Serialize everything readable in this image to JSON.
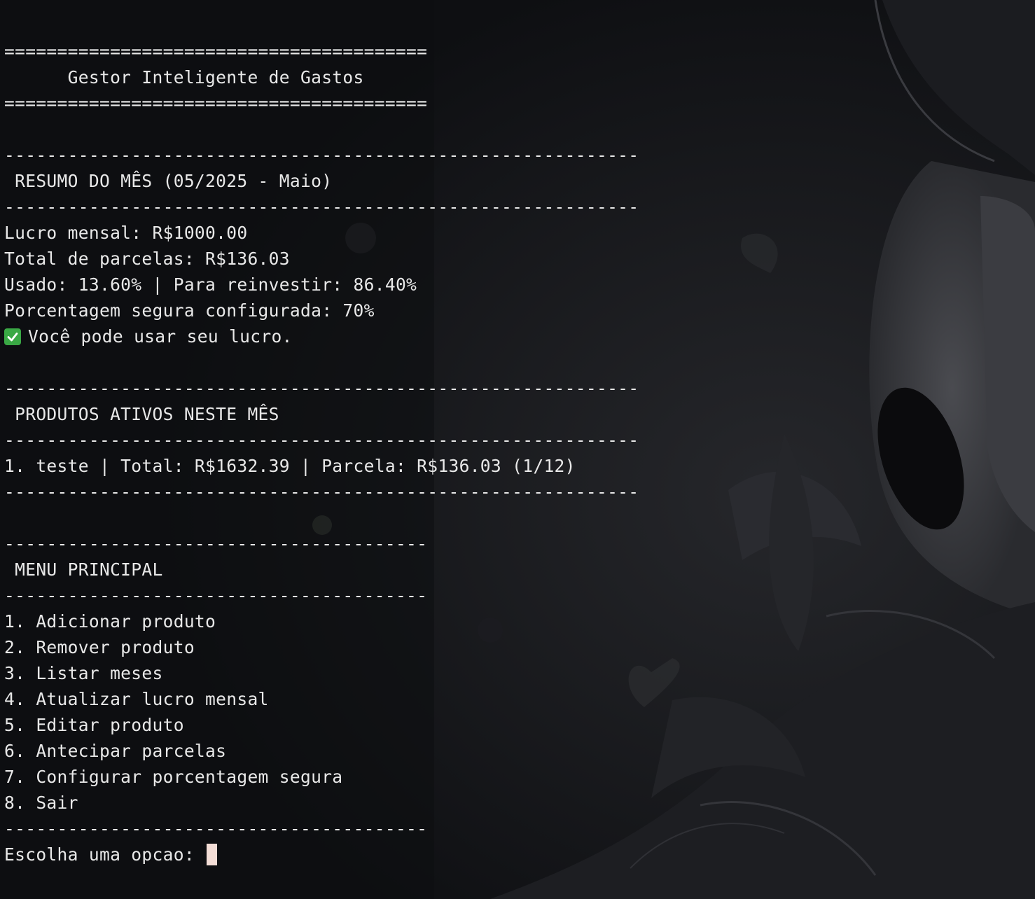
{
  "header": {
    "rule": "========================================",
    "title": "      Gestor Inteligente de Gastos"
  },
  "summary": {
    "rule": "------------------------------------------------------------",
    "heading": " RESUMO DO MÊS (05/2025 - Maio)",
    "lines": [
      "Lucro mensal: R$1000.00",
      "Total de parcelas: R$136.03",
      "Usado: 13.60% | Para reinvestir: 86.40%",
      "Porcentagem segura configurada: 70%"
    ],
    "status_icon": "check-mark-icon",
    "status_text": "Você pode usar seu lucro.",
    "status_color": "#3aa845"
  },
  "products": {
    "rule": "------------------------------------------------------------",
    "heading": " PRODUTOS ATIVOS NESTE MÊS",
    "items": [
      "1. teste | Total: R$1632.39 | Parcela: R$136.03 (1/12)"
    ]
  },
  "menu": {
    "rule": "----------------------------------------",
    "heading": " MENU PRINCIPAL",
    "items": [
      "1. Adicionar produto",
      "2. Remover produto",
      "3. Listar meses",
      "4. Atualizar lucro mensal",
      "5. Editar produto",
      "6. Antecipar parcelas",
      "7. Configurar porcentagem segura",
      "8. Sair"
    ]
  },
  "prompt": {
    "text": "Escolha uma opcao: ",
    "cursor_color": "#f3ddd6"
  }
}
